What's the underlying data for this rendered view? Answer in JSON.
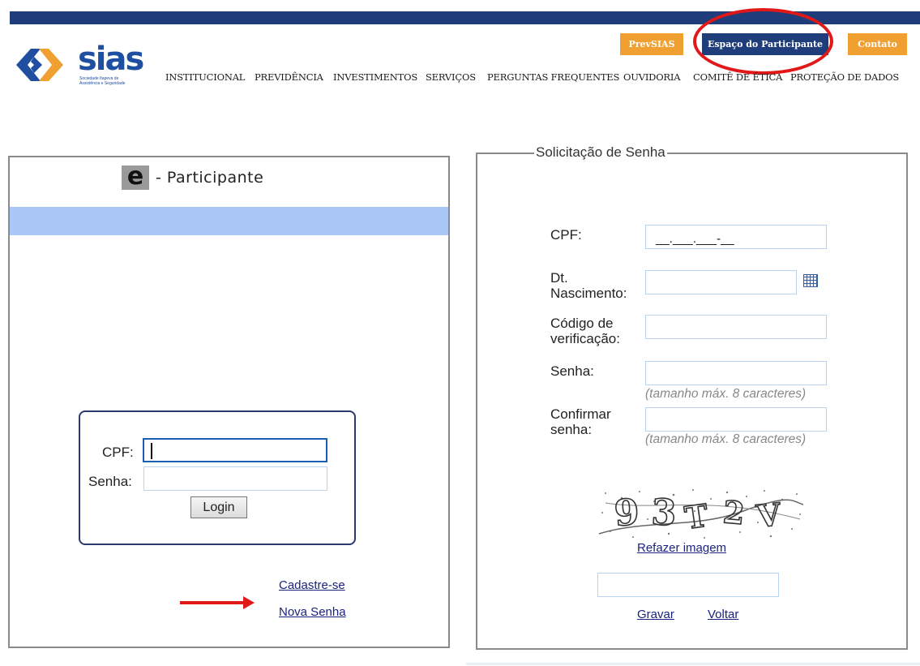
{
  "header": {
    "logo": {
      "word": "sias",
      "tagline": "Sociedade Itapeva de Assistência e Seguridade"
    },
    "buttons": {
      "prevsias": "PrevSIAS",
      "espaco": "Espaço do Participante",
      "contato": "Contato"
    },
    "nav": [
      "INSTITUCIONAL",
      "PREVIDÊNCIA",
      "INVESTIMENTOS",
      "SERVIÇOS",
      "PERGUNTAS FREQUENTES",
      "OUVIDORIA",
      "COMITÊ DE ÉTICA",
      "PROTEÇÃO DE DADOS"
    ]
  },
  "left": {
    "title_e": "e",
    "title_text": "- Participante",
    "login": {
      "cpf_label": "CPF:",
      "senha_label": "Senha:",
      "button": "Login"
    },
    "links": {
      "cadastre": "Cadastre-se",
      "nova_senha": "Nova Senha"
    }
  },
  "right": {
    "legend": "Solicitação de Senha",
    "cpf_label": "CPF:",
    "cpf_mask": "__.___.___-__",
    "dt_label_1": "Dt.",
    "dt_label_2": "Nascimento:",
    "codigo_label_1": "Código de",
    "codigo_label_2": "verificação:",
    "senha_label": "Senha:",
    "hint": "(tamanho máx. 8 caracteres)",
    "confirmar_label_1": "Confirmar",
    "confirmar_label_2": "senha:",
    "captcha_text": "93T2V",
    "refazer": "Refazer imagem",
    "gravar": "Gravar",
    "voltar": "Voltar"
  },
  "colors": {
    "brand_blue": "#1f3d7a",
    "orange": "#f0a030",
    "highlight_red": "#e01818",
    "band_blue": "#abc7f5"
  }
}
